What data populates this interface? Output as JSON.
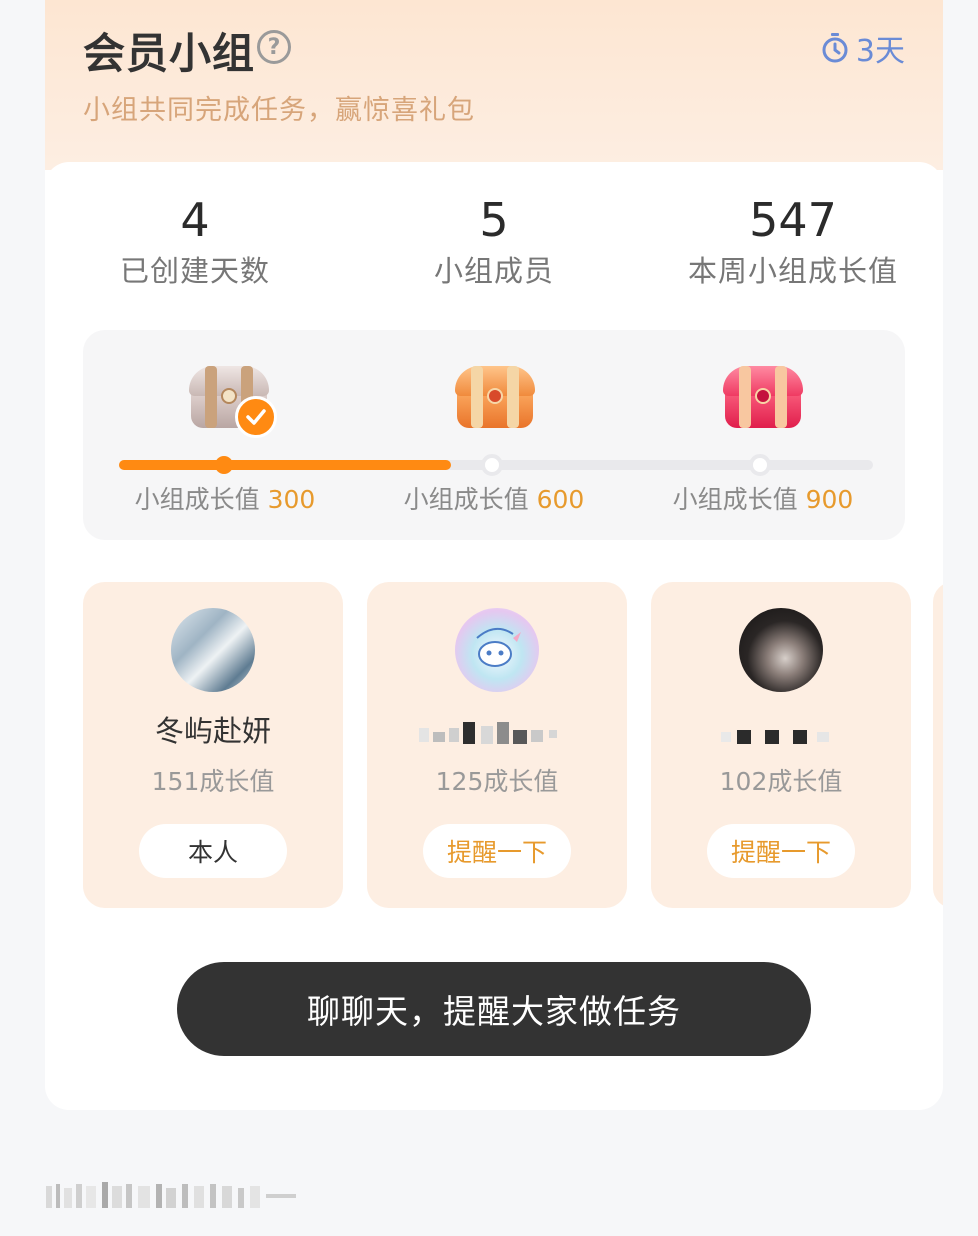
{
  "header": {
    "title": "会员小组",
    "help_icon": "question-circle-icon",
    "timer_icon": "timer-icon",
    "timer_text": "3天",
    "subtitle": "小组共同完成任务，赢惊喜礼包"
  },
  "stats": [
    {
      "value": "4",
      "label": "已创建天数"
    },
    {
      "value": "5",
      "label": "小组成员"
    },
    {
      "value": "547",
      "label": "本周小组成长值"
    }
  ],
  "progress": {
    "fill_fraction": 0.44,
    "milestones": [
      {
        "prefix": "小组成长值",
        "value": "300",
        "reached": true,
        "chest_color": "silver"
      },
      {
        "prefix": "小组成长值",
        "value": "600",
        "reached": false,
        "chest_color": "orange"
      },
      {
        "prefix": "小组成长值",
        "value": "900",
        "reached": false,
        "chest_color": "red"
      }
    ]
  },
  "members": [
    {
      "name": "冬屿赴妍",
      "score": "151成长值",
      "button": "本人",
      "button_type": "self",
      "avatar": "avatar-1"
    },
    {
      "name": "",
      "score": "125成长值",
      "button": "提醒一下",
      "button_type": "remind",
      "avatar": "avatar-2"
    },
    {
      "name": "",
      "score": "102成长值",
      "button": "提醒一下",
      "button_type": "remind",
      "avatar": "avatar-3"
    }
  ],
  "cta": {
    "label": "聊聊天，提醒大家做任务"
  },
  "colors": {
    "accent": "#ff8a12",
    "gold_text": "#e79a2d",
    "timer_blue": "#6a8bd6",
    "header_bg": "#fde6d2",
    "member_bg": "#fdeee2",
    "cta_bg": "#333333"
  }
}
